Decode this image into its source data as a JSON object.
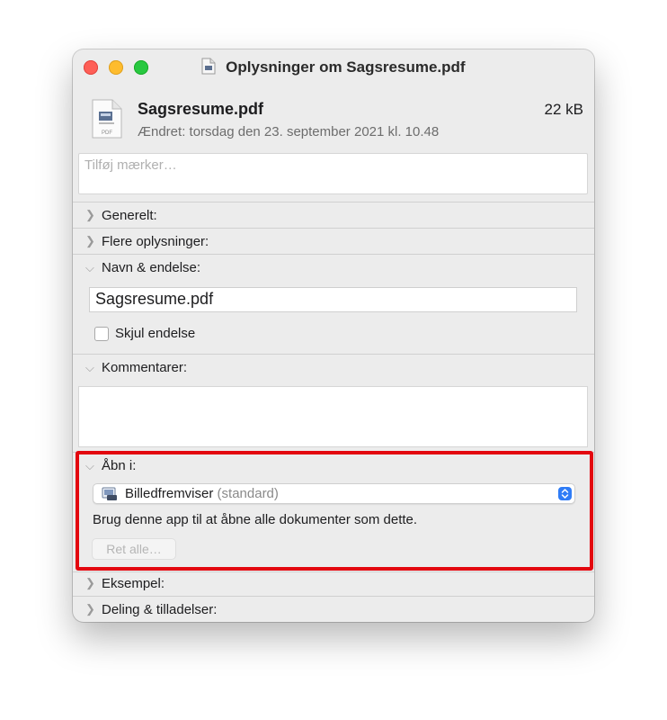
{
  "window": {
    "title": "Oplysninger om Sagsresume.pdf",
    "controls": [
      "close",
      "minimize",
      "zoom"
    ]
  },
  "file": {
    "name": "Sagsresume.pdf",
    "size": "22 kB",
    "modified": "Ændret: torsdag den 23. september 2021 kl. 10.48",
    "icon": "pdf-document-icon",
    "icon_label": "PDF"
  },
  "tags": {
    "placeholder": "Tilføj mærker…"
  },
  "sections": {
    "general": "Generelt:",
    "more_info": "Flere oplysninger:",
    "name_ext": "Navn & endelse:",
    "comments": "Kommentarer:",
    "open_with": "Åbn i:",
    "preview": "Eksempel:",
    "sharing": "Deling & tilladelser:"
  },
  "name_ext": {
    "filename": "Sagsresume.pdf",
    "hide_extension_label": "Skjul endelse",
    "hide_extension_checked": false
  },
  "open_with": {
    "app": "Billedfremviser",
    "default_tag": "(standard)",
    "app_icon": "preview-app-icon",
    "description": "Brug denne app til at åbne alle dokumenter som dette.",
    "change_all": "Ret alle…"
  },
  "highlight_color": "#e3070f"
}
